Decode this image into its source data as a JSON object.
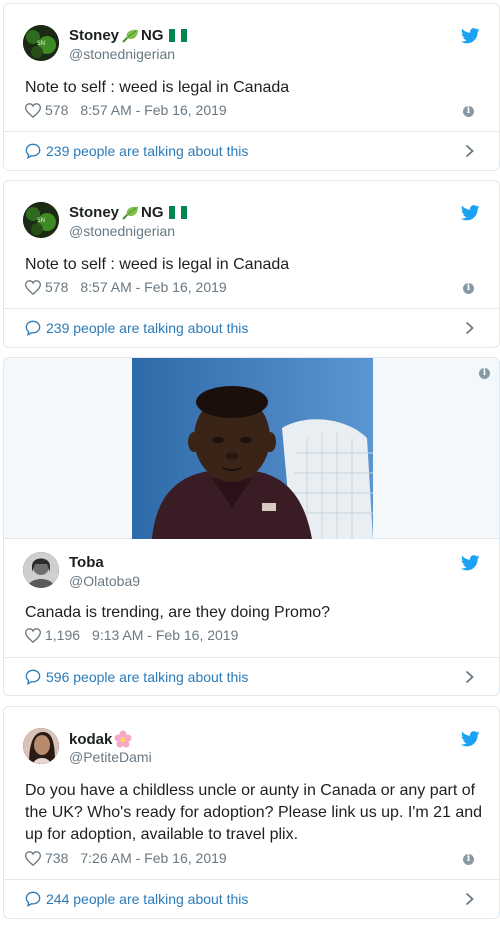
{
  "tweets": [
    {
      "name": "Stoney",
      "name_suffix": "NG",
      "handle": "@stonednigerian",
      "text": "Note to self : weed is legal in Canada",
      "likes": "578",
      "timestamp": "8:57 AM - Feb 16, 2019",
      "talking": "239 people are talking about this"
    },
    {
      "name": "Stoney",
      "name_suffix": "NG",
      "handle": "@stonednigerian",
      "text": "Note to self : weed is legal in Canada",
      "likes": "578",
      "timestamp": "8:57 AM - Feb 16, 2019",
      "talking": "239 people are talking about this"
    },
    {
      "name": "Toba",
      "handle": "@Olatoba9",
      "text": "Canada is trending,  are they doing Promo?",
      "likes": "1,196",
      "timestamp": "9:13 AM - Feb 16, 2019",
      "talking": "596 people are talking about this"
    },
    {
      "name": "kodak",
      "handle": "@PetiteDami",
      "text": "Do you have a childless uncle or aunty in Canada or any part of the UK? Who's ready for adoption? Please link us up. I'm 21 and up for adoption, available to travel plix.",
      "likes": "738",
      "timestamp": "7:26 AM - Feb 16, 2019",
      "talking": "244 people are talking about this"
    }
  ],
  "colors": {
    "twitter_blue": "#1da1f2",
    "link_blue": "#2b7bb9",
    "meta_gray": "#697882",
    "border": "#e1e8ed"
  },
  "icons": [
    "twitter-bird-icon",
    "heart-icon",
    "info-icon",
    "chat-bubble-icon",
    "chevron-right-icon",
    "leaf-emoji-icon",
    "nigeria-flag-icon",
    "flower-emoji-icon"
  ]
}
